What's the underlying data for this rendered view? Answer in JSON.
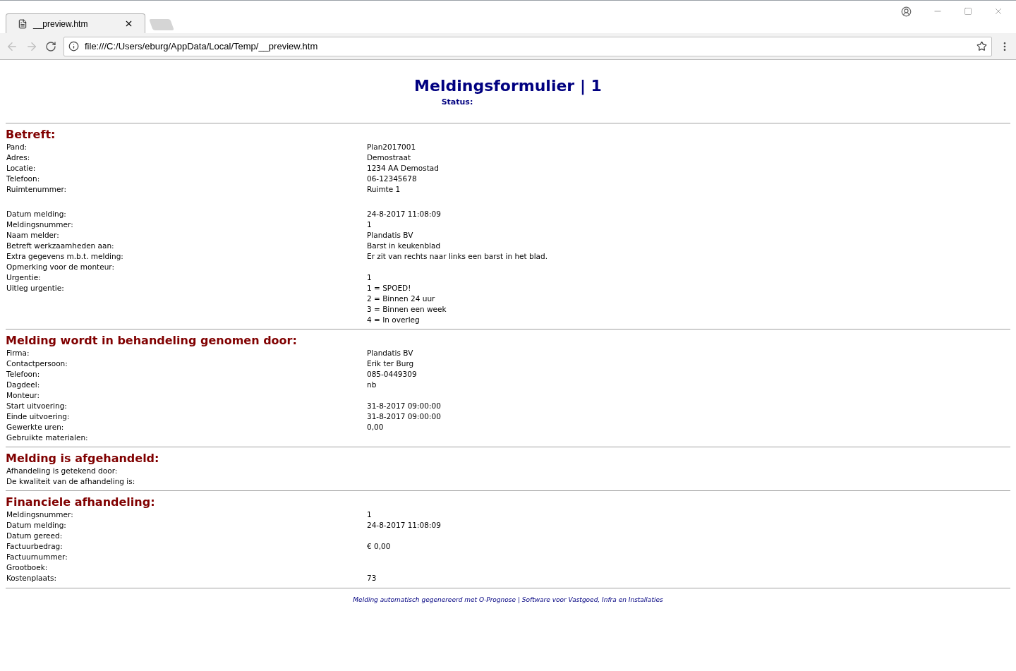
{
  "browser": {
    "tabs": [
      {
        "title": "__preview.htm",
        "selected": true
      }
    ],
    "address": "file:///C:/Users/eburg/AppData/Local/Temp/__preview.htm"
  },
  "header": {
    "title": "Meldingsformulier | 1",
    "status_label": "Status:"
  },
  "sections": [
    {
      "heading": "Betreft:",
      "row_groups": [
        [
          {
            "label": "Pand:",
            "value": [
              "Plan2017001"
            ]
          },
          {
            "label": "Adres:",
            "value": [
              "Demostraat"
            ]
          },
          {
            "label": "Locatie:",
            "value": [
              "1234 AA Demostad"
            ]
          },
          {
            "label": "Telefoon:",
            "value": [
              "06-12345678"
            ]
          },
          {
            "label": "Ruimtenummer:",
            "value": [
              "Ruimte 1"
            ]
          }
        ],
        [
          {
            "label": "Datum melding:",
            "value": [
              "24-8-2017 11:08:09"
            ]
          },
          {
            "label": "Meldingsnummer:",
            "value": [
              "1"
            ]
          },
          {
            "label": "Naam melder:",
            "value": [
              "Plandatis BV"
            ]
          },
          {
            "label": "Betreft werkzaamheden aan:",
            "value": [
              "Barst in keukenblad"
            ]
          },
          {
            "label": "Extra gegevens m.b.t. melding:",
            "value": [
              "Er zit van rechts naar links een barst in het blad."
            ]
          },
          {
            "label": "Opmerking voor de monteur:"
          },
          {
            "label": "Urgentie:",
            "value": [
              "1"
            ]
          },
          {
            "label": "Uitleg urgentie:",
            "value": [
              "1 = SPOED!",
              "2 = Binnen 24 uur",
              "3 = Binnen een week",
              "4 = In overleg"
            ]
          }
        ]
      ]
    },
    {
      "heading": "Melding wordt in behandeling genomen door:",
      "row_groups": [
        [
          {
            "label": "Firma:",
            "value": [
              "Plandatis BV"
            ]
          },
          {
            "label": "Contactpersoon:",
            "value": [
              "Erik ter Burg"
            ]
          },
          {
            "label": "Telefoon:",
            "value": [
              "085-0449309"
            ]
          },
          {
            "label": "Dagdeel:",
            "value": [
              "nb"
            ]
          },
          {
            "label": "Monteur:"
          },
          {
            "label": "Start uitvoering:",
            "value": [
              "31-8-2017 09:00:00"
            ]
          },
          {
            "label": "Einde uitvoering:",
            "value": [
              "31-8-2017 09:00:00"
            ]
          },
          {
            "label": "Gewerkte uren:",
            "value": [
              "0,00"
            ]
          },
          {
            "label": "Gebruikte materialen:"
          }
        ]
      ]
    },
    {
      "heading": "Melding is afgehandeld:",
      "row_groups": [
        [
          {
            "label": "Afhandeling is getekend door:"
          },
          {
            "label": "De kwaliteit van de afhandeling is:"
          }
        ]
      ]
    },
    {
      "heading": "Financiele afhandeling:",
      "row_groups": [
        [
          {
            "label": "Meldingsnummer:",
            "value": [
              "1"
            ]
          },
          {
            "label": "Datum melding:",
            "value": [
              "24-8-2017 11:08:09"
            ]
          },
          {
            "label": "Datum gereed:"
          },
          {
            "label": "Factuurbedrag:",
            "value": [
              "€ 0,00"
            ]
          },
          {
            "label": "Factuurnummer:"
          },
          {
            "label": "Grootboek:"
          },
          {
            "label": "Kostenplaats:",
            "value": [
              "73"
            ]
          }
        ]
      ]
    }
  ],
  "footer": "Melding automatisch gegenereerd met O-Prognose | Software voor Vastgoed, Infra en Installaties"
}
